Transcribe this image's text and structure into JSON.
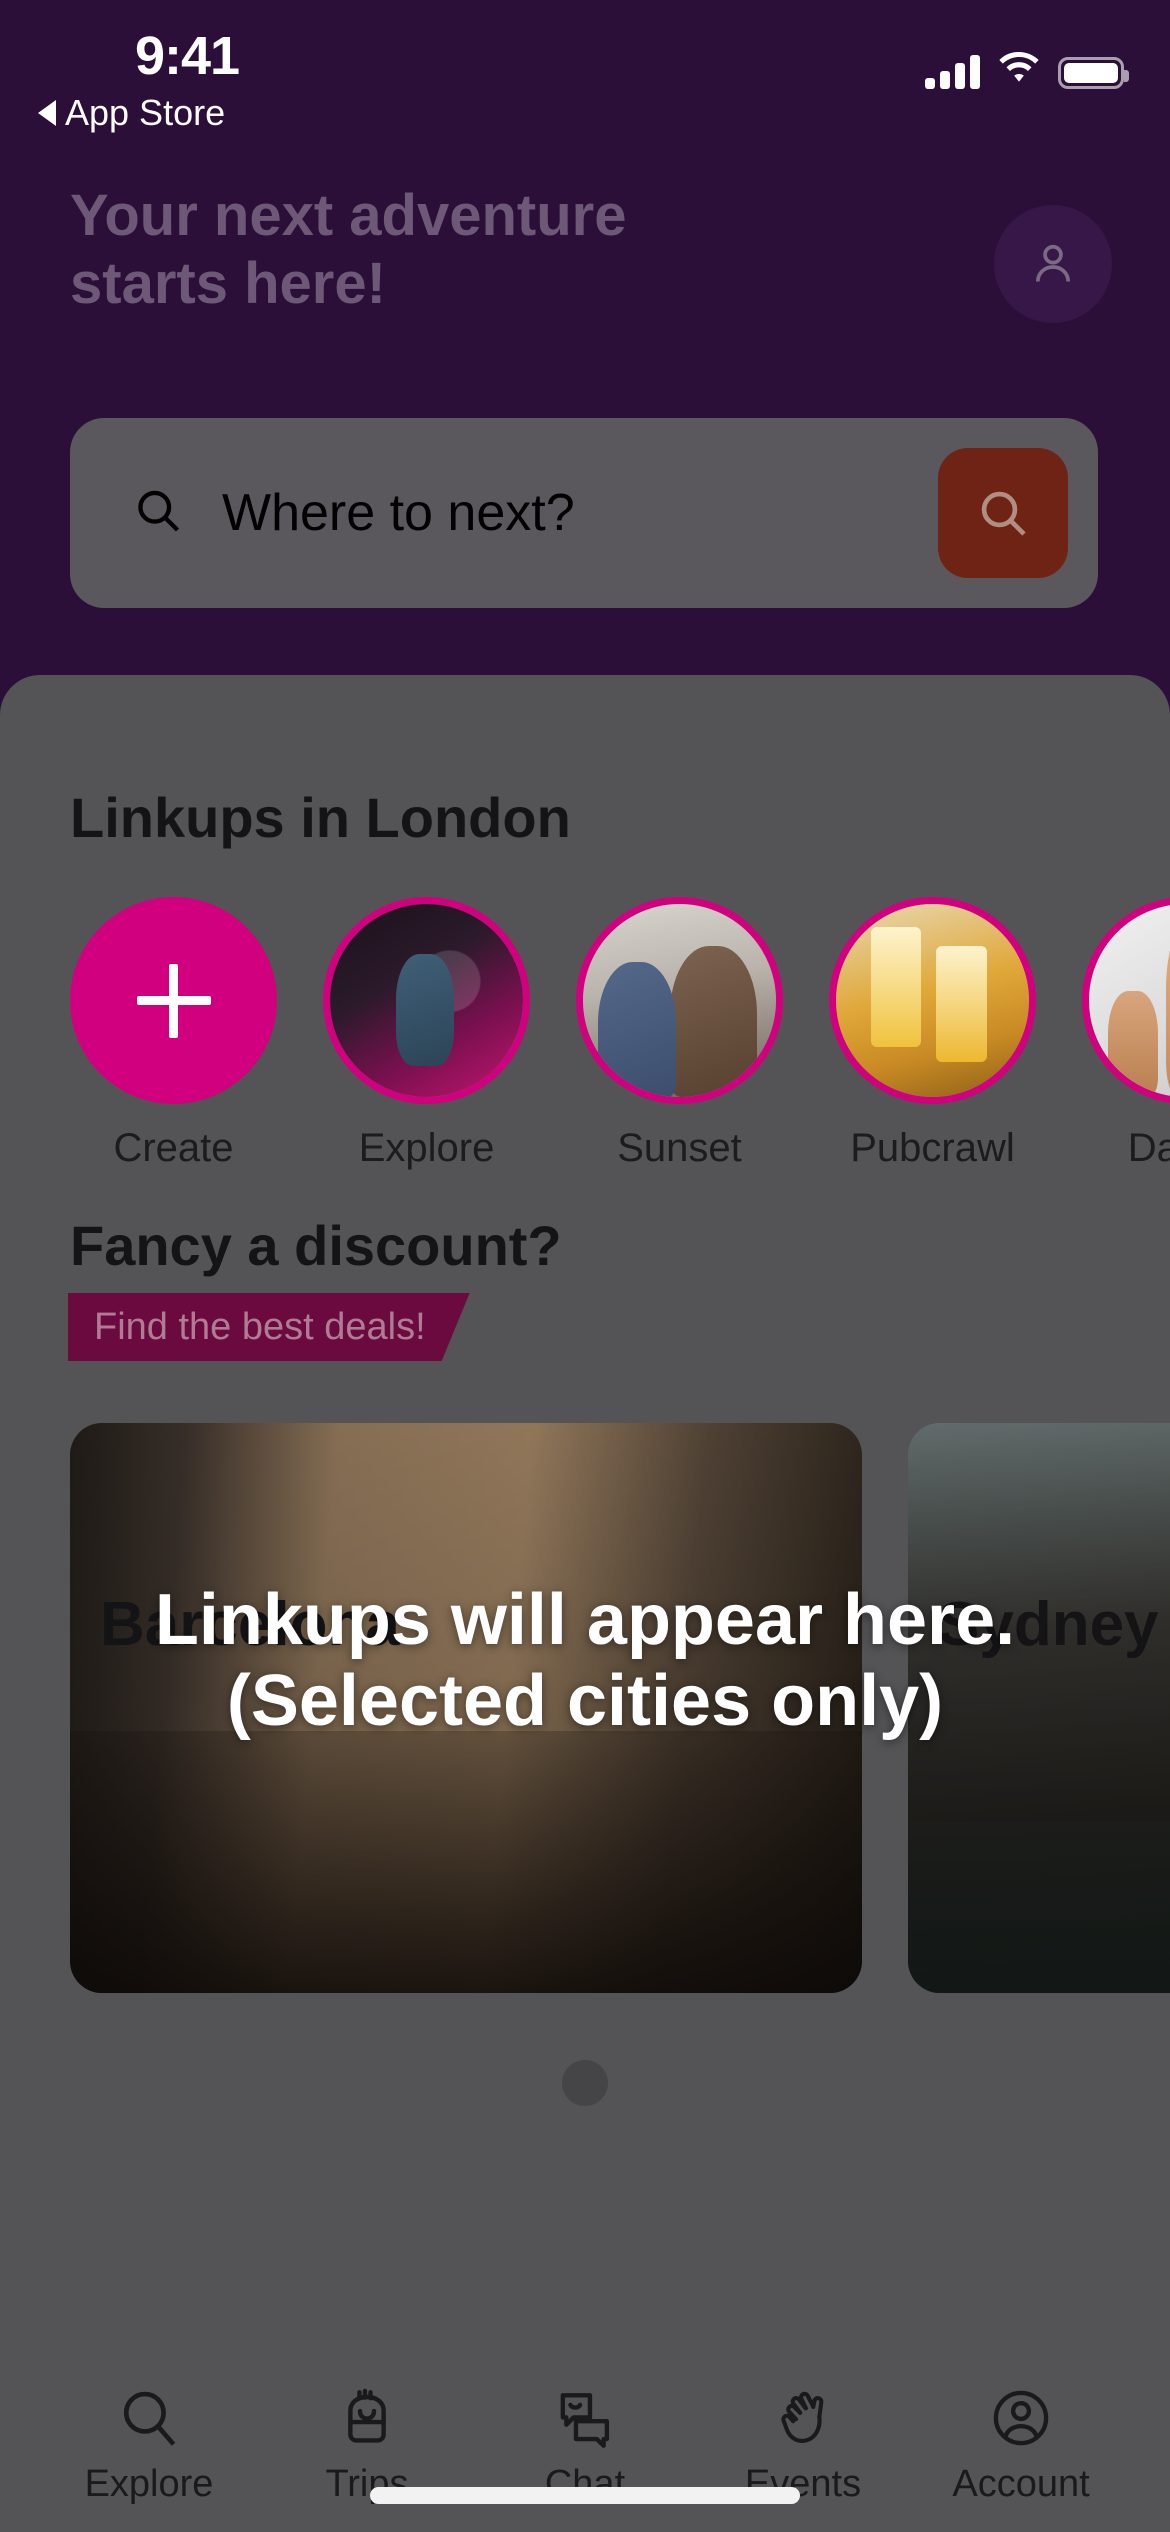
{
  "status_bar": {
    "time": "9:41",
    "back_label": "App Store",
    "signal_icon": "cellular-signal-icon",
    "wifi_icon": "wifi-icon",
    "battery_icon": "battery-full-icon"
  },
  "header": {
    "title": "Your next adventure starts here!",
    "avatar_icon": "person-icon",
    "background_color": "#2b0f39",
    "title_color": "#6d5977"
  },
  "search": {
    "placeholder": "Where to next?",
    "value": "",
    "leading_icon": "search-icon",
    "button_icon": "search-icon",
    "button_color": "#6e2315",
    "field_color": "#5a585d"
  },
  "linkups": {
    "title": "Linkups in London",
    "accent_color": "#d1007f",
    "stories": [
      {
        "label": "Create",
        "type": "create",
        "icon": "plus-icon"
      },
      {
        "label": "Explore",
        "type": "photo",
        "photo": "ph-explore"
      },
      {
        "label": "Sunset",
        "type": "photo",
        "photo": "ph-sunset"
      },
      {
        "label": "Pubcrawl",
        "type": "photo",
        "photo": "ph-pub"
      },
      {
        "label": "Dance",
        "type": "photo",
        "photo": "ph-dance"
      }
    ]
  },
  "discount": {
    "title": "Fancy a discount?",
    "badge": "Find the best deals!",
    "badge_color": "#6b0a3e",
    "badge_text_color": "#b07b95"
  },
  "cities": [
    {
      "name": "Barcelona",
      "image": "img-barcelona"
    },
    {
      "name": "Sydney",
      "image": "img-sydney"
    }
  ],
  "pager": {
    "dots": 1,
    "active": 0
  },
  "overlay": {
    "line1": "Linkups will appear here.",
    "line2": "(Selected cities only)"
  },
  "tabbar": {
    "items": [
      {
        "label": "Explore",
        "icon": "search-icon"
      },
      {
        "label": "Trips",
        "icon": "backpack-icon"
      },
      {
        "label": "Chat",
        "icon": "chat-bubbles-icon"
      },
      {
        "label": "Events",
        "icon": "waving-hand-icon"
      },
      {
        "label": "Account",
        "icon": "account-circle-icon"
      }
    ]
  }
}
